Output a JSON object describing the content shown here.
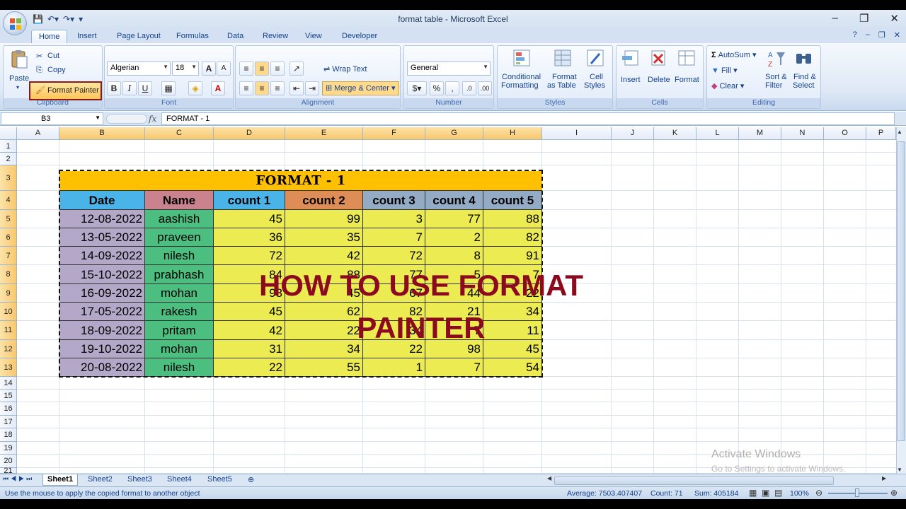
{
  "window": {
    "title": "format table - Microsoft Excel"
  },
  "tabs": [
    "Home",
    "Insert",
    "Page Layout",
    "Formulas",
    "Data",
    "Review",
    "View",
    "Developer"
  ],
  "ribbon": {
    "clipboard": {
      "paste": "Paste",
      "cut": "Cut",
      "copy": "Copy",
      "format_painter": "Format Painter",
      "label": "Clipboard"
    },
    "font": {
      "name": "Algerian",
      "size": "18",
      "bold": "B",
      "italic": "I",
      "underline": "U",
      "label": "Font"
    },
    "alignment": {
      "wrap_text": "Wrap Text",
      "merge_center": "Merge & Center",
      "label": "Alignment"
    },
    "number": {
      "format": "General",
      "percent": "%",
      "comma": ",",
      "label": "Number"
    },
    "styles": {
      "conditional": "Conditional",
      "conditional2": "Formatting",
      "format_as": "Format",
      "format_as2": "as Table",
      "cell": "Cell",
      "cell2": "Styles",
      "label": "Styles"
    },
    "cells": {
      "insert": "Insert",
      "delete": "Delete",
      "format": "Format",
      "label": "Cells"
    },
    "editing": {
      "autosum": "AutoSum",
      "fill": "Fill",
      "clear": "Clear",
      "sort": "Sort &",
      "sort2": "Filter",
      "find": "Find &",
      "find2": "Select",
      "label": "Editing"
    }
  },
  "formula_bar": {
    "name_box": "B3",
    "fx": "fx",
    "content": "FORMAT - 1"
  },
  "columns": [
    "A",
    "B",
    "C",
    "D",
    "E",
    "F",
    "G",
    "H",
    "I",
    "J",
    "K",
    "L",
    "M",
    "N",
    "O",
    "P"
  ],
  "rows": [
    "1",
    "2",
    "3",
    "4",
    "5",
    "6",
    "7",
    "8",
    "9",
    "10",
    "11",
    "12",
    "13",
    "14",
    "15",
    "16",
    "17",
    "18",
    "19",
    "20",
    "21"
  ],
  "table": {
    "title": "FORMAT - 1",
    "headers": [
      "Date",
      "Name",
      "count  1",
      "count  2",
      "count 3",
      "count 4",
      "count 5"
    ],
    "rows": [
      [
        "12-08-2022",
        "aashish",
        "45",
        "99",
        "3",
        "77",
        "88"
      ],
      [
        "13-05-2022",
        "praveen",
        "36",
        "35",
        "7",
        "2",
        "82"
      ],
      [
        "14-09-2022",
        "nilesh",
        "72",
        "42",
        "72",
        "8",
        "91"
      ],
      [
        "15-10-2022",
        "prabhash",
        "84",
        "88",
        "77",
        "5",
        "7"
      ],
      [
        "16-09-2022",
        "mohan",
        "98",
        "45",
        "67",
        "44",
        "22"
      ],
      [
        "17-05-2022",
        "rakesh",
        "45",
        "62",
        "82",
        "21",
        "34"
      ],
      [
        "18-09-2022",
        "pritam",
        "42",
        "22",
        "34",
        "7",
        "11"
      ],
      [
        "19-10-2022",
        "mohan",
        "31",
        "34",
        "22",
        "98",
        "45"
      ],
      [
        "20-08-2022",
        "nilesh",
        "22",
        "55",
        "1",
        "7",
        "54"
      ]
    ],
    "header_colors": [
      "#4ab4e8",
      "#c9828e",
      "#4ab4e8",
      "#de8d57",
      "#94abc6",
      "#94abc6",
      "#94abc6"
    ],
    "colors": {
      "date_bg": "#b3a8c8",
      "name_bg": "#4cbe7f",
      "counts_bg": "#ecec52",
      "title_bg": "#ffc000"
    }
  },
  "overlay": {
    "line1": "HOW TO USE FORMAT",
    "line2": "PAINTER",
    "color": "#8b0a1f"
  },
  "sheets": [
    "Sheet1",
    "Sheet2",
    "Sheet3",
    "Sheet4",
    "Sheet5"
  ],
  "status": {
    "message": "Use the mouse to apply the copied format to another object",
    "average": "Average: 7503.407407",
    "count": "Count: 71",
    "sum": "Sum: 405184",
    "zoom": "100%"
  },
  "watermark": {
    "line1": "Activate Windows",
    "line2": "Go to Settings to activate Windows."
  }
}
